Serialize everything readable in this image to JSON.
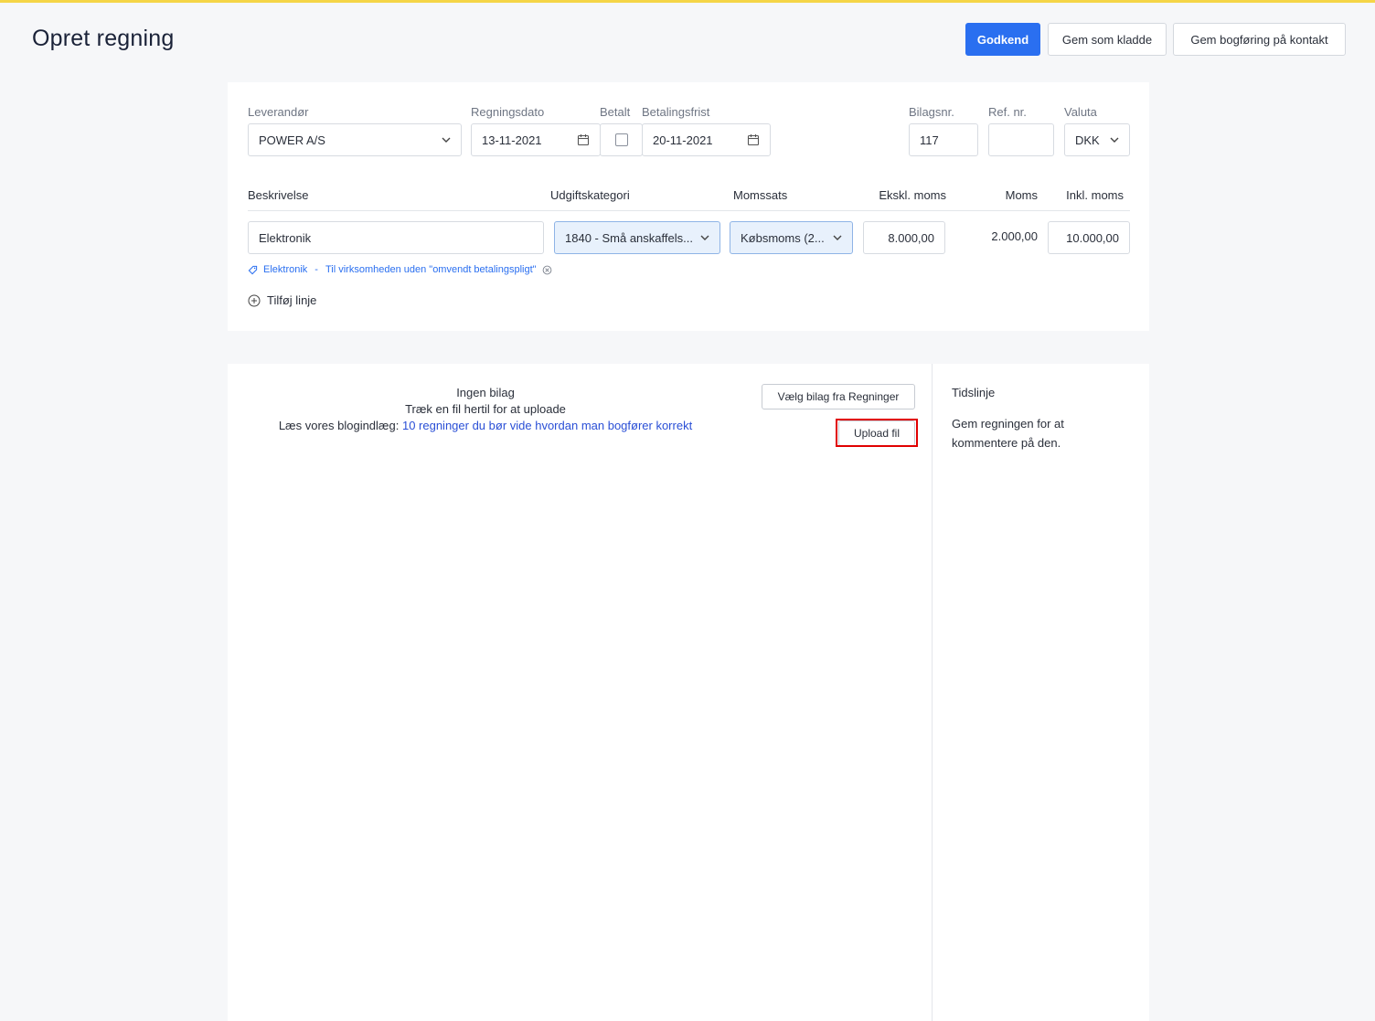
{
  "page": {
    "title": "Opret regning"
  },
  "actions": {
    "approve": "Godkend",
    "save_draft": "Gem som kladde",
    "save_posting": "Gem bogføring på kontakt"
  },
  "form": {
    "supplier": {
      "label": "Leverandør",
      "value": "POWER A/S"
    },
    "bill_date": {
      "label": "Regningsdato",
      "value": "13-11-2021"
    },
    "paid": {
      "label": "Betalt",
      "checked": false
    },
    "due_date": {
      "label": "Betalingsfrist",
      "value": "20-11-2021"
    },
    "voucher_no": {
      "label": "Bilagsnr.",
      "value": "117"
    },
    "ref_no": {
      "label": "Ref. nr.",
      "value": ""
    },
    "currency": {
      "label": "Valuta",
      "value": "DKK"
    }
  },
  "lines": {
    "headers": {
      "description": "Beskrivelse",
      "category": "Udgiftskategori",
      "vat_rate": "Momssats",
      "excl_vat": "Ekskl. moms",
      "vat": "Moms",
      "incl_vat": "Inkl. moms"
    },
    "rows": [
      {
        "description": "Elektronik",
        "category": "1840 - Små anskaffels...",
        "vat_rate": "Købsmoms (2...",
        "excl_vat": "8.000,00",
        "vat": "2.000,00",
        "incl_vat": "10.000,00",
        "tag": "Elektronik",
        "tag_separator": "-",
        "tag_note": "Til virksomheden uden \"omvendt betalingspligt\""
      }
    ],
    "add_line": "Tilføj linje"
  },
  "attachments": {
    "empty_title": "Ingen bilag",
    "drag_hint": "Træk en fil hertil for at uploade",
    "blog_prefix": "Læs vores blogindlæg:",
    "blog_link": "10 regninger du bør vide hvordan man bogfører korrekt",
    "choose_button": "Vælg bilag fra Regninger",
    "upload_button": "Upload fil"
  },
  "timeline": {
    "title": "Tidslinje",
    "line1": "Gem regningen for at",
    "line2": "kommentere på den."
  },
  "colors": {
    "accent": "#2a6ff0",
    "topbar": "#f5d547",
    "highlight": "#e00000"
  }
}
